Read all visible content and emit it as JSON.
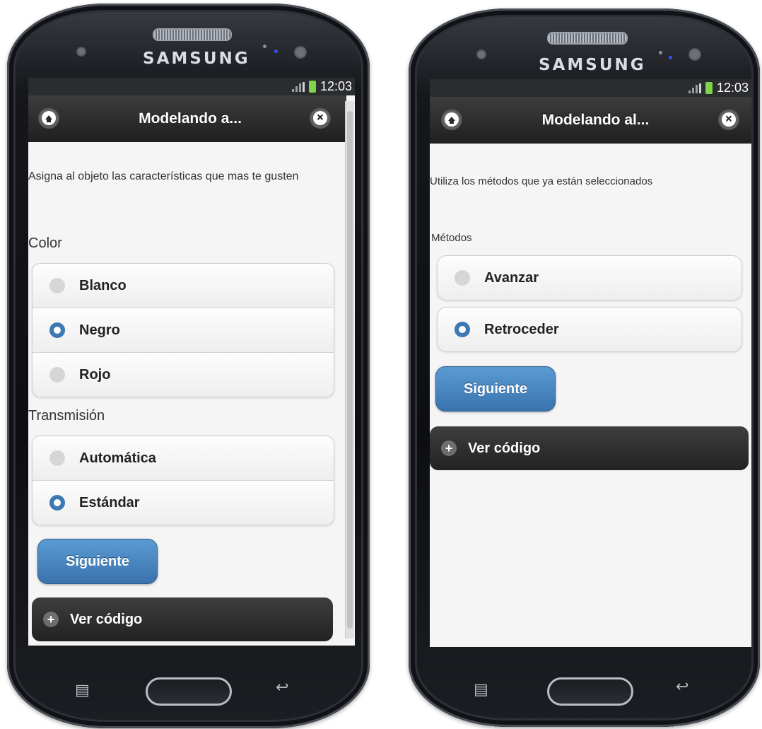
{
  "left_phone": {
    "brand": "SAMSUNG",
    "time": "12:03",
    "header_title": "Modelando a...",
    "intro": "Asigna al objeto las características que mas te gusten",
    "groups": [
      {
        "label": "Color",
        "options": [
          {
            "label": "Blanco",
            "selected": false
          },
          {
            "label": "Negro",
            "selected": true
          },
          {
            "label": "Rojo",
            "selected": false
          }
        ]
      },
      {
        "label": "Transmisión",
        "options": [
          {
            "label": "Automática",
            "selected": false
          },
          {
            "label": "Estándar",
            "selected": true
          }
        ]
      }
    ],
    "next_button": "Siguiente",
    "code_toggle": "Ver código"
  },
  "right_phone": {
    "brand": "SAMSUNG",
    "time": "12:03",
    "header_title": "Modelando al...",
    "intro": "Utiliza los métodos que ya están seleccionados",
    "group": {
      "label": "Métodos",
      "options": [
        {
          "label": "Avanzar",
          "selected": false
        },
        {
          "label": "Retroceder",
          "selected": true
        }
      ]
    },
    "next_button": "Siguiente",
    "code_toggle": "Ver código"
  },
  "colors": {
    "accent_blue": "#3c79b4",
    "header_dark": "#1f1f1f",
    "battery_green": "#7fd34a"
  },
  "icons": {
    "home": "home-icon",
    "close": "close-icon",
    "plus": "plus-icon",
    "menu": "menu-key-icon",
    "back": "back-key-icon"
  }
}
